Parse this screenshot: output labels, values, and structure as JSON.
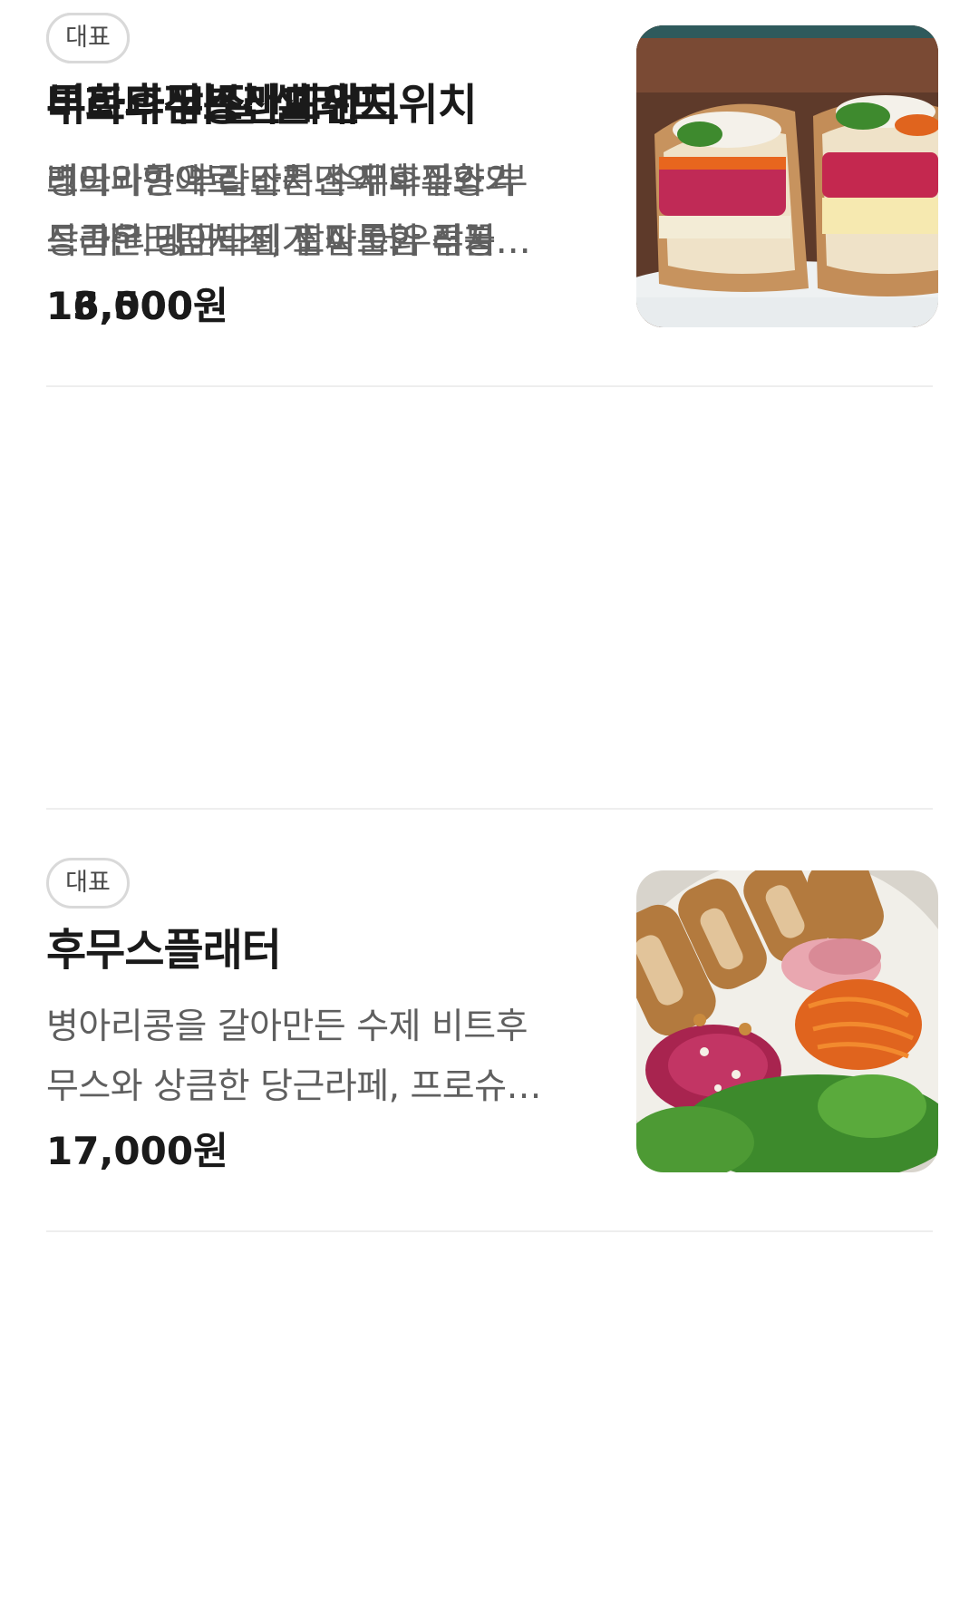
{
  "menu": {
    "items": [
      {
        "badge": "대표",
        "name": "부라타 바질 샐러드",
        "desc_line1": "크리미한 부라타치즈와 바질향가",
        "desc_line2": "득 마리네이드된 토마토와 루꼴…",
        "price": "16,500원",
        "photo_icon": "burrata-salad-photo"
      },
      {
        "badge": "대표",
        "name": "후무스플래터",
        "desc_line1": "병아리콩을 갈아만든 수제 비트후",
        "desc_line2": "무스와 상큼한 당근라페, 프로슈…",
        "price": "17,000원",
        "photo_icon": "hummus-platter-photo"
      },
      {
        "badge": "대표",
        "name": "무화과잠봉샌드위치",
        "desc_line1": "레드와인에 잘조려낸 무화과와 부",
        "desc_line2": "드라운크림치즈, 짭짜롬한 잠봉…",
        "price": "13,000원",
        "photo_icon": "fig-jambon-sandwich-photo"
      },
      {
        "badge": "대표",
        "name": "비트후무스라페샌드위치",
        "desc_line1": "병아리콩으로 만든 수제후무스와",
        "desc_line2": "상큼한 당근라페가 잘 어우러지…",
        "price": "13,500원",
        "photo_icon": "beet-hummus-sandwich-photo"
      }
    ]
  },
  "colors": {
    "text_primary": "#1a1a1a",
    "text_secondary": "#5f5f5f",
    "badge_border": "#d9d9d9",
    "divider": "#eeeeee"
  }
}
